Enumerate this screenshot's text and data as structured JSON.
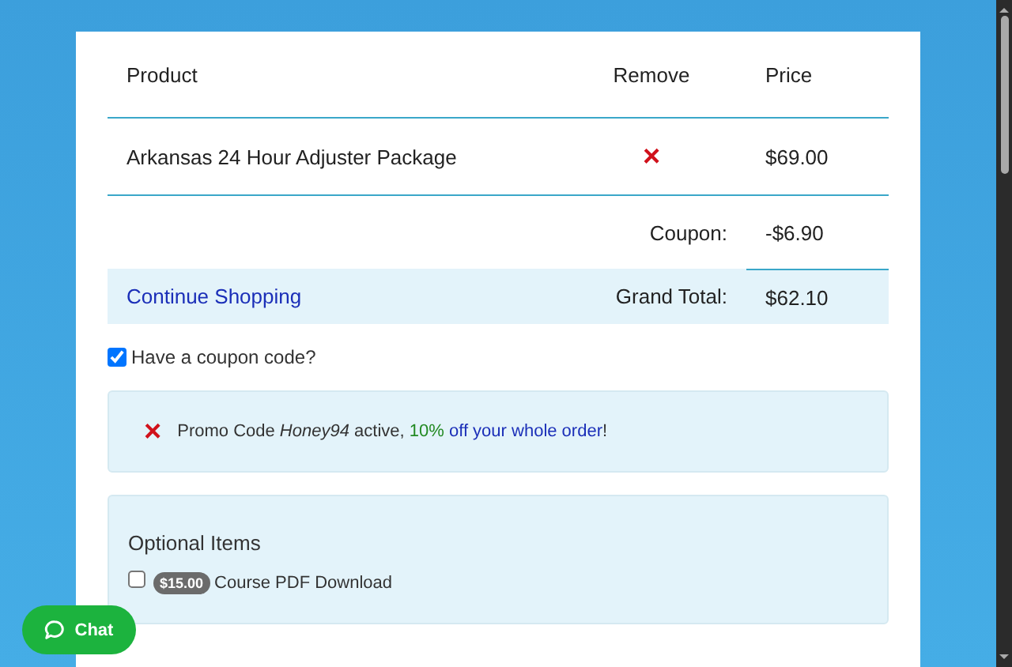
{
  "cart": {
    "columns": [
      "Product",
      "Remove",
      "Price"
    ],
    "rows": [
      {
        "product": "Arkansas 24 Hour Adjuster Package",
        "remove": "×",
        "price": "$69.00"
      }
    ],
    "coupon": {
      "label": "Coupon:",
      "value": "-$6.90"
    },
    "continue_link": "Continue Shopping",
    "grand_total": {
      "label": "Grand Total:",
      "value": "$62.10"
    }
  },
  "coupon_toggle": {
    "label": "Have a coupon code?",
    "checked": true
  },
  "promo": {
    "icon": "×",
    "text": "Promo Code *Honey94* active,",
    "highlight": "10%",
    "rest": "off your whole order",
    "end": "!"
  },
  "optional": {
    "title": "Optional Items",
    "items": [
      {
        "price": "$15.00",
        "label": "Course PDF Download",
        "checked": false
      }
    ]
  },
  "chat": {
    "label": "Chat"
  }
}
